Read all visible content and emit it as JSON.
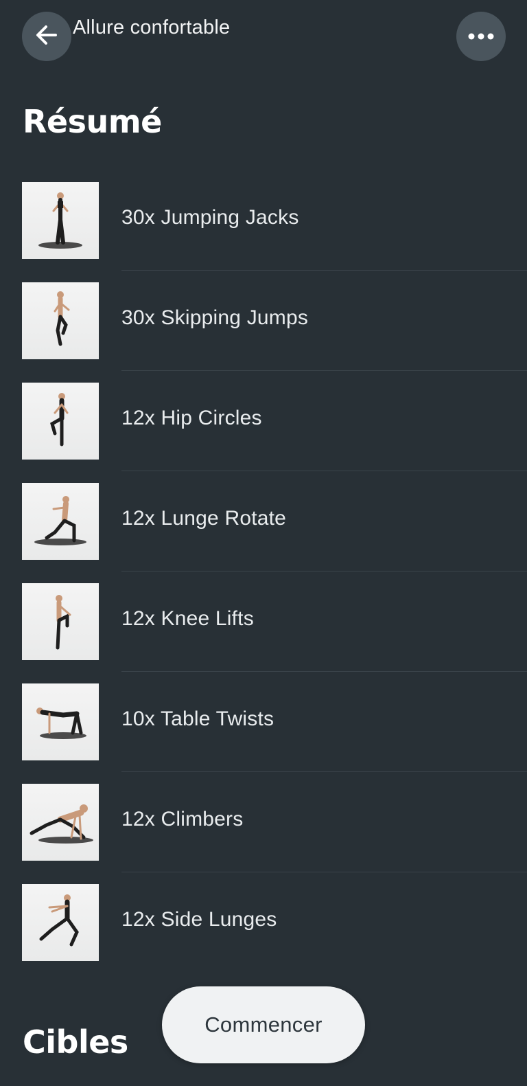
{
  "nav": {
    "title": "Allure confortable",
    "back_icon": "arrow-left-icon",
    "more_icon": "more-horizontal-icon"
  },
  "summary": {
    "title": "Résumé",
    "exercises": [
      {
        "label": "30x Jumping Jacks",
        "pose": "standing-arms-up"
      },
      {
        "label": "30x Skipping Jumps",
        "pose": "skipping"
      },
      {
        "label": "12x Hip Circles",
        "pose": "knee-raise"
      },
      {
        "label": "12x Lunge Rotate",
        "pose": "lunge"
      },
      {
        "label": "12x Knee Lifts",
        "pose": "knee-lift"
      },
      {
        "label": "10x Table Twists",
        "pose": "table"
      },
      {
        "label": "12x Climbers",
        "pose": "plank"
      },
      {
        "label": "12x Side Lunges",
        "pose": "side-lunge"
      }
    ]
  },
  "targets": {
    "title": "Cibles"
  },
  "start_button": {
    "label": "Commencer"
  },
  "colors": {
    "background": "#283036",
    "button_bg": "#4a555d",
    "start_bg": "#f0f2f3",
    "text": "#e9ecee"
  }
}
